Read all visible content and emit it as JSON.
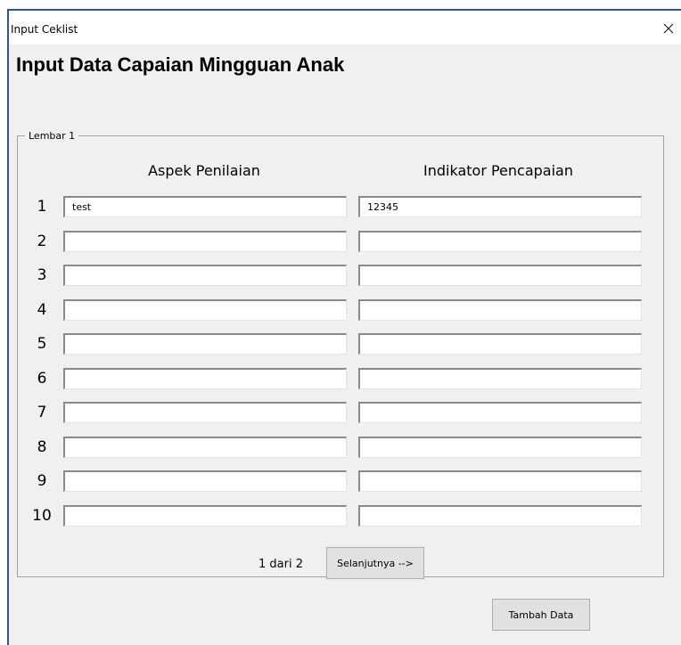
{
  "window": {
    "title": "Input Ceklist",
    "close_icon": "close-icon"
  },
  "heading": "Input Data Capaian Mingguan Anak",
  "frame": {
    "legend": "Lembar 1",
    "columns": [
      "Aspek Penilaian",
      "Indikator Pencapaian"
    ],
    "rows": [
      {
        "num": "1",
        "aspek": "test",
        "indikator": "12345"
      },
      {
        "num": "2",
        "aspek": "",
        "indikator": ""
      },
      {
        "num": "3",
        "aspek": "",
        "indikator": ""
      },
      {
        "num": "4",
        "aspek": "",
        "indikator": ""
      },
      {
        "num": "5",
        "aspek": "",
        "indikator": ""
      },
      {
        "num": "6",
        "aspek": "",
        "indikator": ""
      },
      {
        "num": "7",
        "aspek": "",
        "indikator": ""
      },
      {
        "num": "8",
        "aspek": "",
        "indikator": ""
      },
      {
        "num": "9",
        "aspek": "",
        "indikator": ""
      },
      {
        "num": "10",
        "aspek": "",
        "indikator": ""
      }
    ]
  },
  "pager": {
    "text": "1 dari 2",
    "next_label": "Selanjutnya -->"
  },
  "actions": {
    "add_label": "Tambah Data"
  }
}
